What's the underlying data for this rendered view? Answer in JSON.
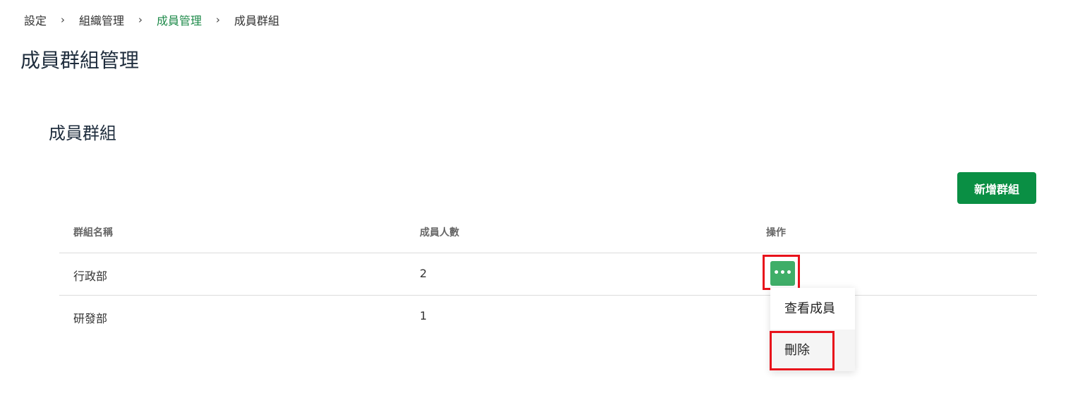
{
  "breadcrumb": {
    "items": [
      {
        "label": "設定"
      },
      {
        "label": "組織管理"
      },
      {
        "label": "成員管理"
      },
      {
        "label": "成員群組"
      }
    ],
    "separator": "›"
  },
  "page_title": "成員群組管理",
  "section_title": "成員群組",
  "add_group_button": "新增群組",
  "table": {
    "headers": [
      "群組名稱",
      "成員人數",
      "操作"
    ],
    "rows": [
      {
        "name": "行政部",
        "count": "2"
      },
      {
        "name": "研發部",
        "count": "1"
      }
    ]
  },
  "action_button_label": "•••",
  "dropdown": {
    "items": [
      {
        "label": "查看成員"
      },
      {
        "label": "刪除"
      }
    ]
  },
  "colors": {
    "primary_green": "#0a8f44",
    "action_green": "#3fae68",
    "active_breadcrumb": "#1e8a4a",
    "highlight_red": "#e8121b"
  }
}
